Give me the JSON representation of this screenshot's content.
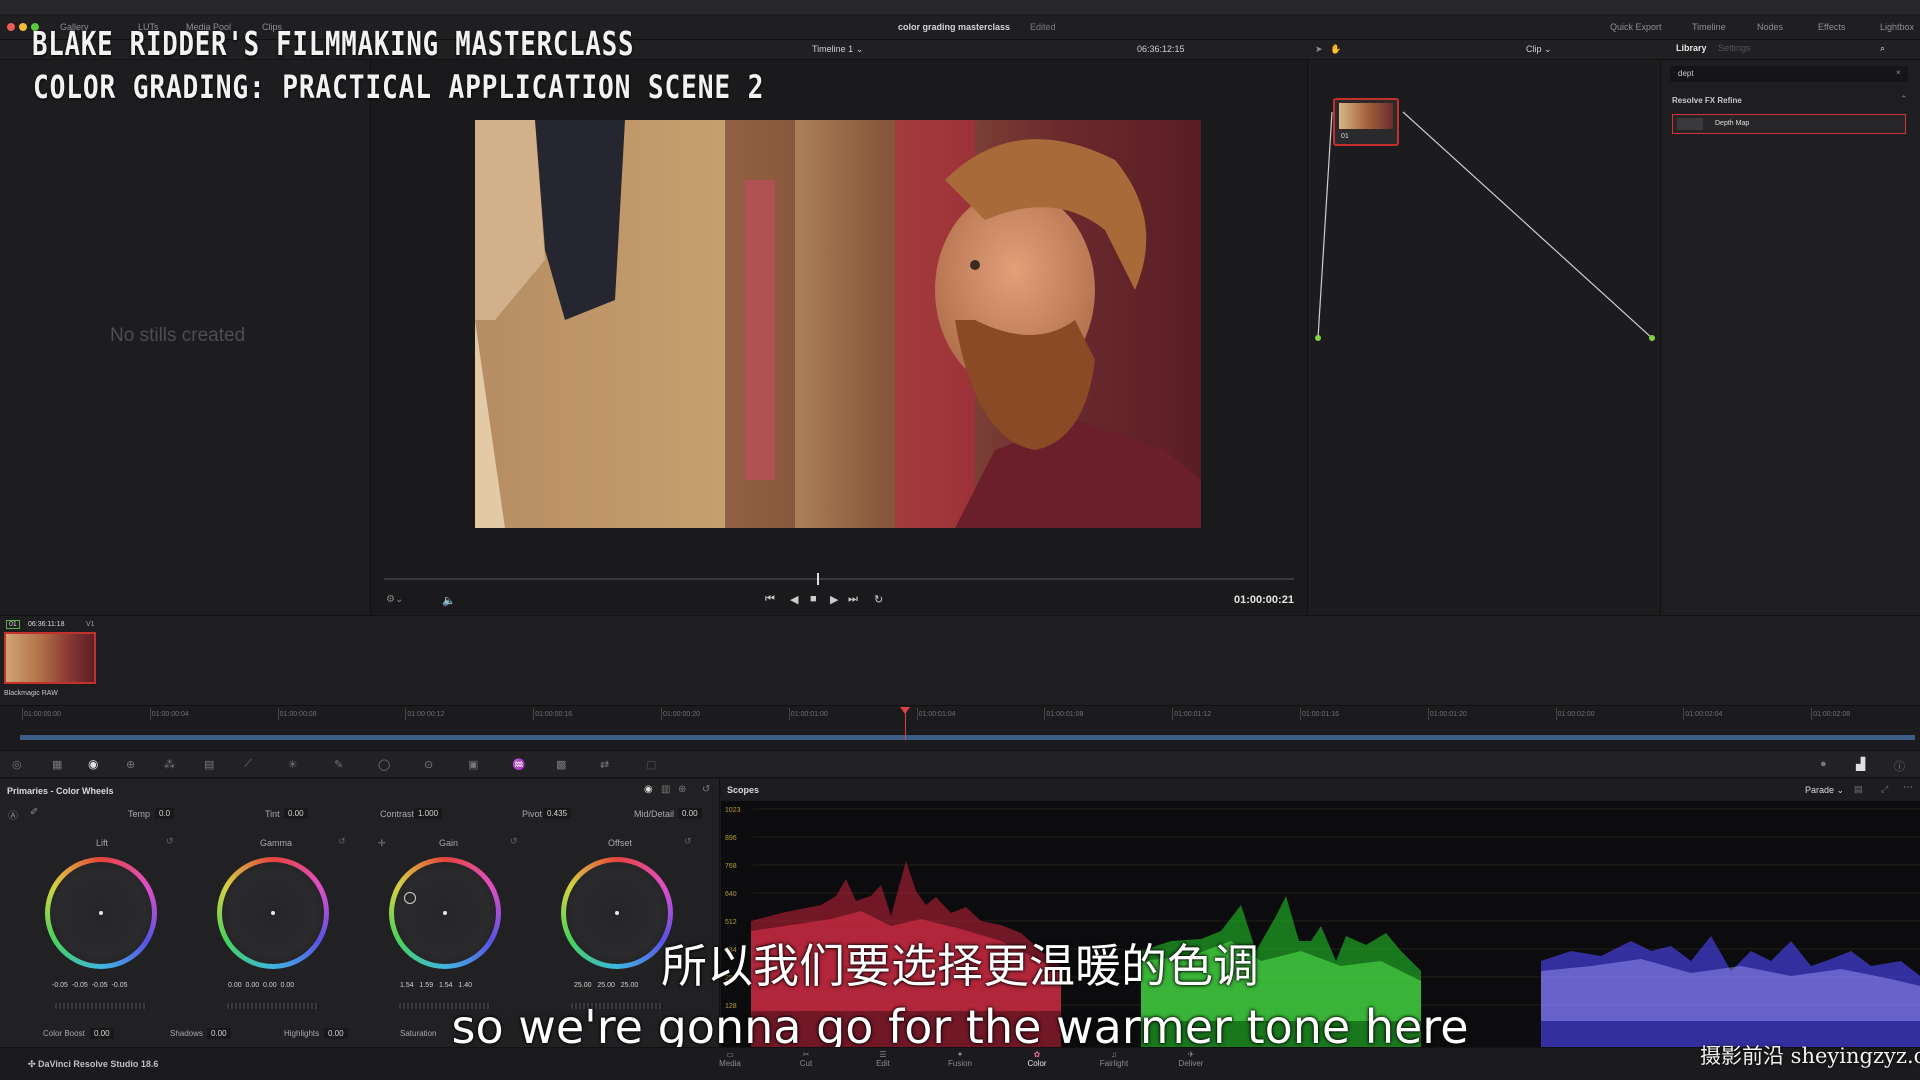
{
  "window": {
    "title": "color grading masterclass",
    "status": "Edited"
  },
  "overlay": {
    "course_title": "BLAKE RIDDER'S FILMMAKING MASTERCLASS",
    "course_subtitle": "COLOR GRADING: PRACTICAL APPLICATION SCENE 2"
  },
  "top_nav": {
    "gallery": "Gallery",
    "luts": "LUTs",
    "media_pool": "Media Pool",
    "clips": "Clips",
    "quick_export": "Quick Export",
    "timeline": "Timeline",
    "nodes": "Nodes",
    "effects": "Effects",
    "lightbox": "Lightbox"
  },
  "viewer": {
    "timeline_name": "Timeline 1",
    "source_timecode": "06:36:12:15",
    "clip_mode": "Clip",
    "current_timecode": "01:00:00:21"
  },
  "gallery": {
    "empty_text": "No stills created"
  },
  "nodes": {
    "node_label": "01"
  },
  "library": {
    "tab_library": "Library",
    "tab_settings": "Settings",
    "search_value": "dept",
    "section": "Resolve FX Refine",
    "item": "Depth Map"
  },
  "clip_strip": {
    "clip_number": "01",
    "clip_timecode": "06:36:11:18",
    "track": "V1",
    "codec": "Blackmagic RAW"
  },
  "ruler_ticks": [
    "01:00:00:00",
    "01:00:00:04",
    "01:00:00:08",
    "01:00:00:12",
    "01:00:00:16",
    "01:00:00:20",
    "01:00:01:00",
    "01:00:01:04",
    "01:00:01:08",
    "01:00:01:12",
    "01:00:01:16",
    "01:00:01:20",
    "01:00:02:00",
    "01:00:02:04",
    "01:00:02:08"
  ],
  "primaries": {
    "title": "Primaries - Color Wheels",
    "temp_label": "Temp",
    "temp": "0.0",
    "tint_label": "Tint",
    "tint": "0.00",
    "contrast_label": "Contrast",
    "contrast": "1.000",
    "pivot_label": "Pivot",
    "pivot": "0.435",
    "mid_label": "Mid/Detail",
    "mid": "0.00",
    "wheels": [
      {
        "name": "Lift",
        "values": [
          "-0.05",
          "-0.05",
          "-0.05",
          "-0.05"
        ]
      },
      {
        "name": "Gamma",
        "values": [
          "0.00",
          "0.00",
          "0.00",
          "0.00"
        ]
      },
      {
        "name": "Gain",
        "values": [
          "1.54",
          "1.59",
          "1.54",
          "1.40"
        ]
      },
      {
        "name": "Offset",
        "values": [
          "25.00",
          "25.00",
          "25.00",
          ""
        ]
      }
    ],
    "color_boost_label": "Color Boost",
    "color_boost": "0.00",
    "shadows_label": "Shadows",
    "shadows": "0.00",
    "highlights_label": "Highlights",
    "highlights": "0.00",
    "saturation_label": "Saturation"
  },
  "scopes": {
    "title": "Scopes",
    "mode": "Parade",
    "axis": [
      "1023",
      "896",
      "768",
      "640",
      "512",
      "384",
      "256",
      "128"
    ]
  },
  "pages": [
    "Media",
    "Cut",
    "Edit",
    "Fusion",
    "Color",
    "Fairlight",
    "Deliver"
  ],
  "active_page": "Color",
  "app_name": "DaVinci Resolve Studio 18.6",
  "subtitles": {
    "cn": "所以我们要选择更温暖的色调",
    "en": "so we're gonna go for the warmer tone here"
  },
  "watermark": "摄影前沿 sheyingzyz.com",
  "colors": {
    "accent_red": "#c4302b",
    "scope_red": "#e0233f",
    "scope_green": "#2fe02f",
    "scope_blue": "#5b55ff"
  }
}
